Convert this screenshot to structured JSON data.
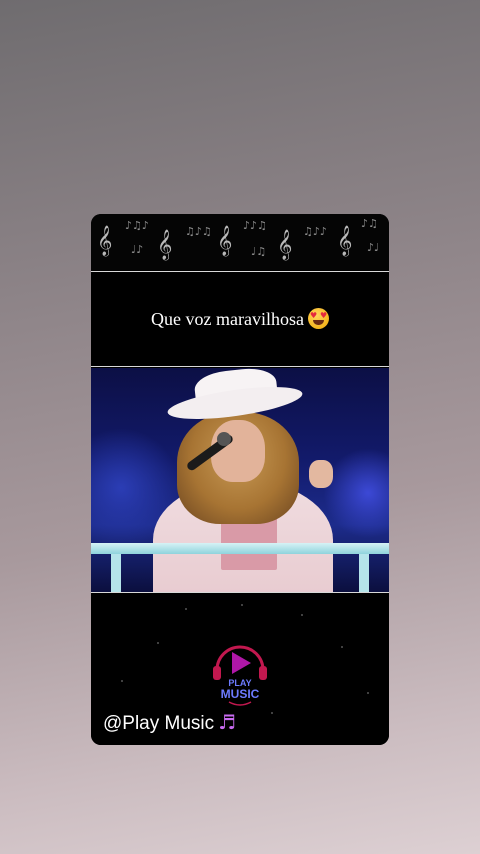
{
  "post": {
    "caption": "Que voz maravilhosa",
    "caption_emoji": "heart-eyes-emoji",
    "handle": "@Play Music",
    "handle_icon": "music-note-icon",
    "handle_icon_glyph": "♬"
  },
  "logo": {
    "line1": "PLAY",
    "line2": "MUSIC",
    "colors": {
      "ring": "#c2184f",
      "text": "#6d7bff",
      "play": "#b017a8"
    }
  },
  "decor": {
    "clef_glyph": "𝄞",
    "note_glyph": "♪"
  }
}
